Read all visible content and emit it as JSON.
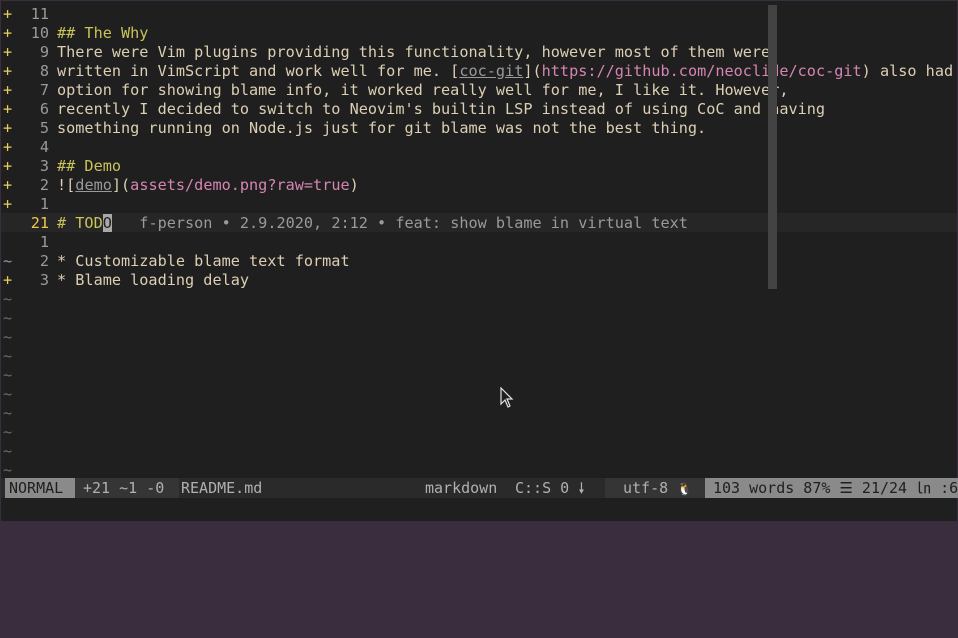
{
  "lines": [
    {
      "sign": "+",
      "num": "11",
      "text": ""
    },
    {
      "sign": "+",
      "num": "10",
      "text": "## The Why",
      "kind": "heading"
    },
    {
      "sign": "+",
      "num": "9",
      "text": "There were Vim plugins providing this functionality, however most of them were"
    },
    {
      "sign": "+",
      "num": "8",
      "pre": "written in VimScript and work well for me. [",
      "link": "coc-git",
      "mid": "](",
      "url": "https://github.com/neoclide/coc-git",
      "post": ") also had",
      "kind": "link"
    },
    {
      "sign": "+",
      "num": "7",
      "text": "option for showing blame info, it worked really well for me, I like it. However,"
    },
    {
      "sign": "+",
      "num": "6",
      "text": "recently I decided to switch to Neovim's builtin LSP instead of using CoC and having"
    },
    {
      "sign": "+",
      "num": "5",
      "text": "something running on Node.js just for git blame was not the best thing."
    },
    {
      "sign": "+",
      "num": "4",
      "text": ""
    },
    {
      "sign": "+",
      "num": "3",
      "text": "## Demo",
      "kind": "heading"
    },
    {
      "sign": "+",
      "num": "2",
      "pre": "![",
      "link": "demo",
      "mid": "](",
      "url": "assets/demo.png?raw=true",
      "post": ")",
      "kind": "link"
    },
    {
      "sign": "+",
      "num": "1",
      "text": ""
    },
    {
      "sign": "",
      "num": "21",
      "text_before": "# TOD",
      "cursor_char": "O",
      "virtual": "   f-person • 2.9.2020, 2:12 • feat: show blame in virtual text",
      "kind": "current"
    },
    {
      "sign": "",
      "num": "1",
      "text": ""
    },
    {
      "sign": "~",
      "num": "2",
      "text": "* Customizable blame text format",
      "kind": "modified"
    },
    {
      "sign": "+",
      "num": "3",
      "text": "* Blame loading delay"
    }
  ],
  "tilde_lines": [
    "~",
    "~",
    "~",
    "~",
    "~",
    "~",
    "~",
    "~",
    "~",
    "~"
  ],
  "statusbar": {
    "mode": "NORMAL",
    "git": "+21 ~1 -0",
    "filename": "README.md",
    "filetype": "markdown",
    "lsp": "C::S 0",
    "lsp_icon": "🠗",
    "encoding": "utf-8",
    "os_icon": "🐧",
    "position": "103 words 87% ☰ 21/24 ㏑ :6"
  },
  "colors": {
    "accent": "#f0c94a",
    "heading": "#c9c35a",
    "url": "#d685b1",
    "background": "#1f1f1f"
  },
  "icons": [
    "mouse-pointer-icon",
    "linux-icon",
    "lsp-arrow-icon"
  ]
}
